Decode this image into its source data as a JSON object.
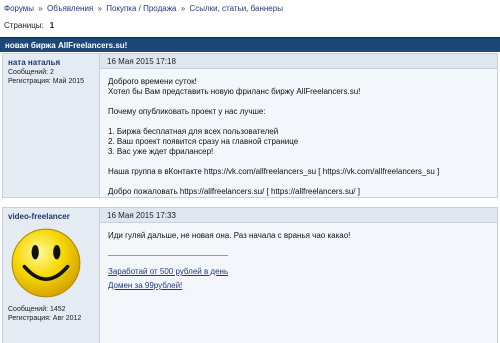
{
  "breadcrumb": {
    "items": [
      "Форумы",
      "Объявления",
      "Покупка / Продажа",
      "Ссылки, статьи, баннеры"
    ],
    "separator": "»"
  },
  "pages": {
    "label": "Страницы:",
    "current": "1"
  },
  "thread": {
    "title": "новая биржа AllFreelancers.su!"
  },
  "posts": [
    {
      "author": "ната наталья",
      "messages": "Сообщений: 2",
      "registered": "Регистрация: Май 2015",
      "date": "16 Мая 2015 17:18",
      "lines": [
        "Доброго времени суток!",
        "Хотел бы Вам представить новую фриланс биржу AllFreelancers.su!",
        "",
        "Почему опубликовать проект у нас лучше:",
        "",
        "1. Биржа бесплатная для всех пользователей",
        "2. Ваш проект появится сразу на главной странице",
        "3. Вас уже ждет фрилансер!",
        "",
        "Наша группа в вКонтакте https://vk.com/allfreelancers_su [ https://vk.com/allfreelancers_su ]",
        "",
        "Добро пожаловать https://allfreelancers.su/ [ https://allfreelancers.su/ ]"
      ]
    },
    {
      "author": "video-freelancer",
      "messages": "Сообщений: 1452",
      "registered": "Регистрация: Авг 2012",
      "date": "16 Мая 2015 17:33",
      "text": "Иди гуляй дальше, не новая она. Раз начала с вранья чао какао!",
      "signature": [
        "Заработай от 500 рублей в день",
        "Домен за 99рублей!"
      ],
      "avatar_icon": "smiley-face-icon"
    }
  ]
}
